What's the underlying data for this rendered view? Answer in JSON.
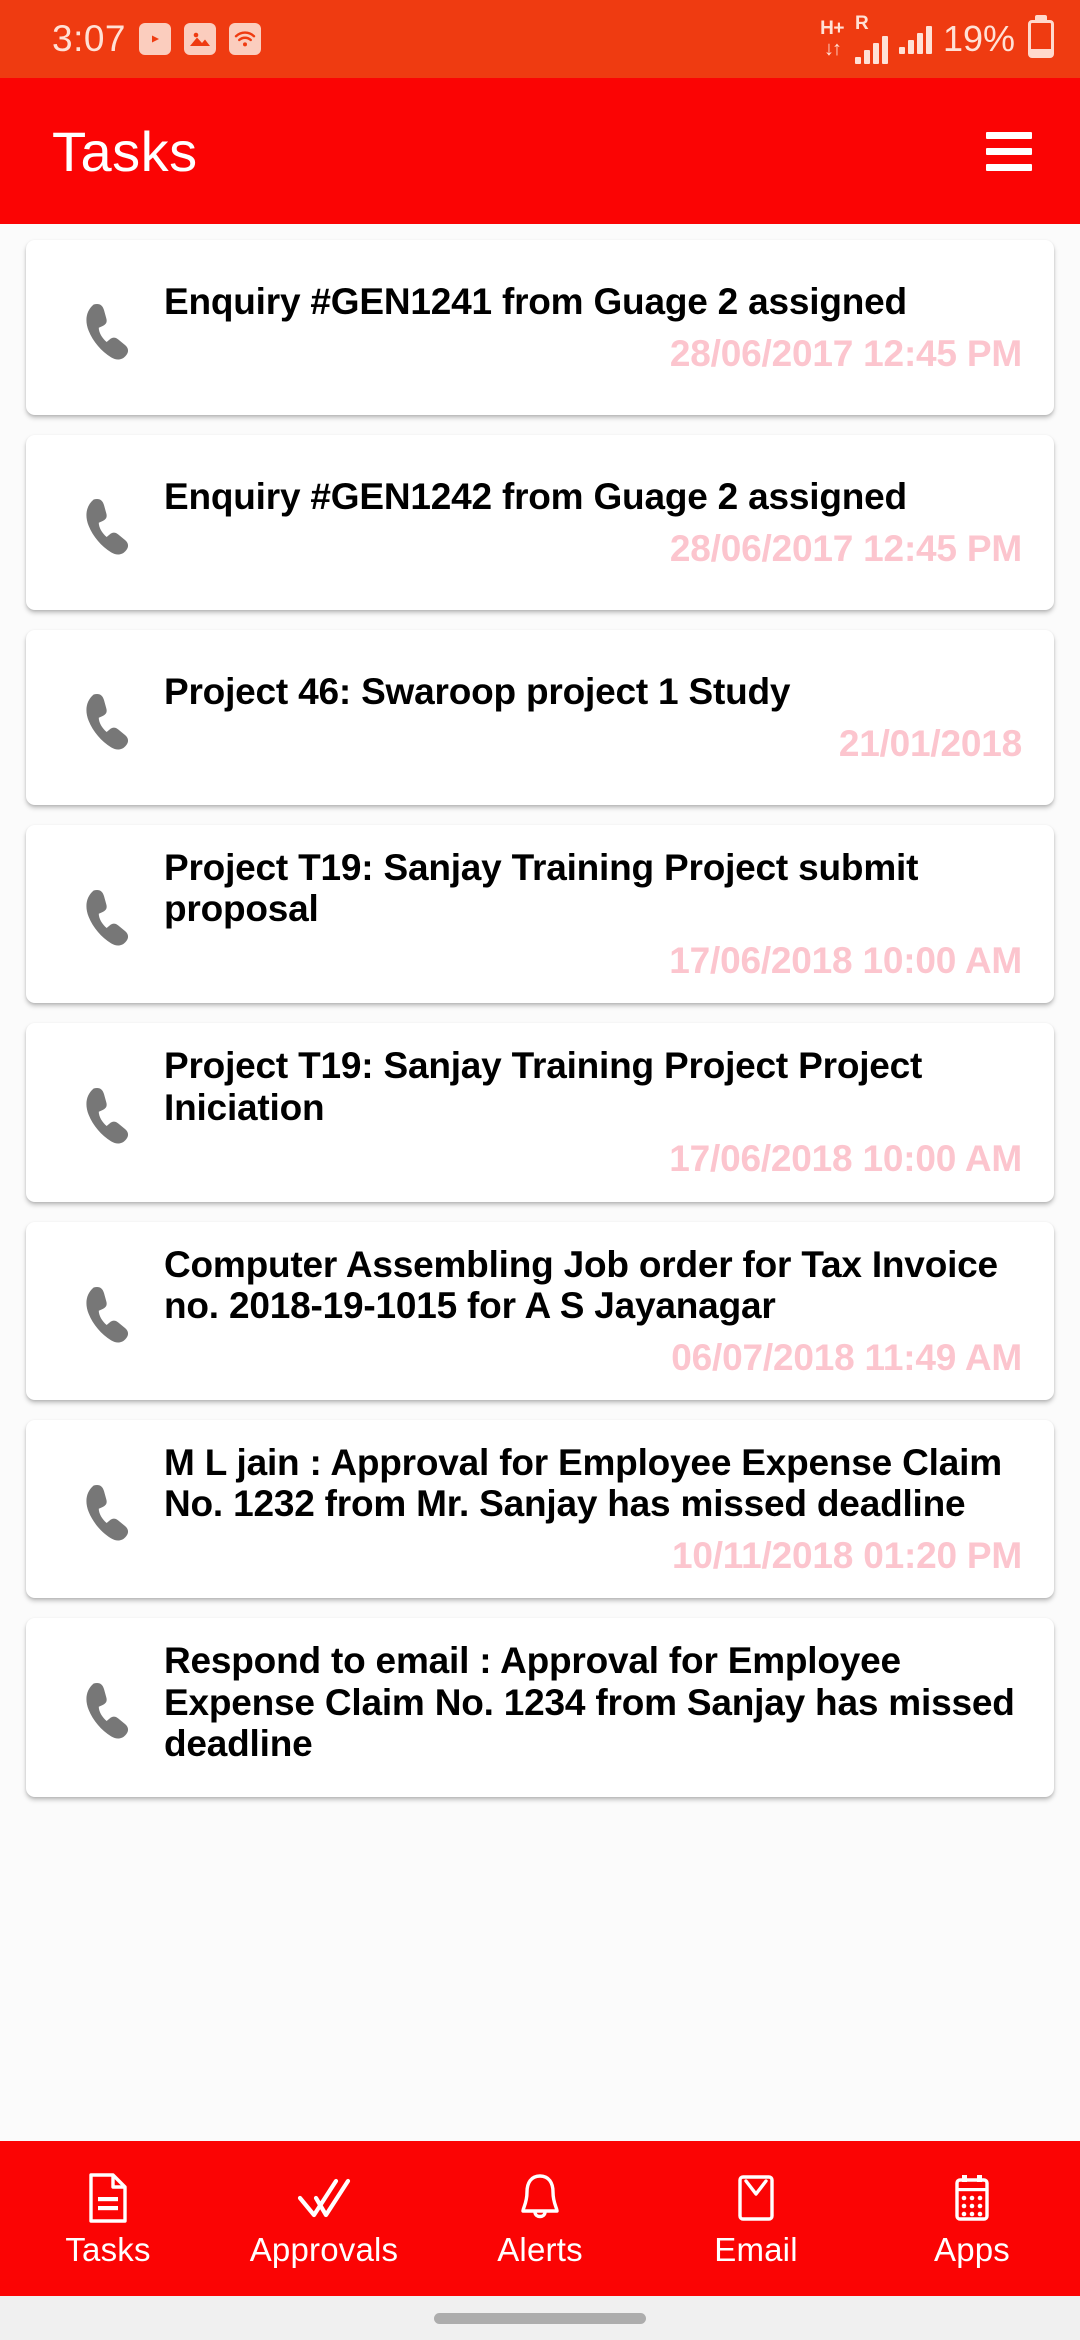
{
  "status_bar": {
    "clock": "3:07",
    "left_icons": [
      "youtube-icon",
      "gallery-icon",
      "wifi-icon"
    ],
    "network_type": "H+",
    "network_arrows": "↓↑",
    "roaming_label": "R",
    "battery_percent": "19%",
    "battery_level": 19,
    "background_color": "#ef3b11",
    "foreground_color": "#ffe1d6"
  },
  "app_bar": {
    "title": "Tasks",
    "menu_icon": "hamburger-icon",
    "background_color": "#fb0404",
    "text_color": "#ffffff"
  },
  "colors": {
    "accent": "#fb0404",
    "status_bar": "#ef3b11",
    "card_background": "#ffffff",
    "page_background": "#fbfbfb",
    "date_text": "#fcc5ce",
    "title_text": "#000000",
    "icon_gray": "#777777",
    "gesture_bar": "#f0f0f0"
  },
  "tasks": [
    {
      "icon": "phone-icon",
      "title": "Enquiry #GEN1241 from Guage 2 assigned",
      "date": "28/06/2017 12:45 PM"
    },
    {
      "icon": "phone-icon",
      "title": "Enquiry #GEN1242 from Guage 2 assigned",
      "date": "28/06/2017 12:45 PM"
    },
    {
      "icon": "phone-icon",
      "title": "Project 46: Swaroop project 1 Study",
      "date": "21/01/2018"
    },
    {
      "icon": "phone-icon",
      "title": "Project T19: Sanjay Training Project submit proposal",
      "date": "17/06/2018 10:00 AM"
    },
    {
      "icon": "phone-icon",
      "title": "Project T19: Sanjay Training Project Project Iniciation",
      "date": "17/06/2018 10:00 AM"
    },
    {
      "icon": "phone-icon",
      "title": "Computer Assembling Job order for Tax Invoice no. 2018-19-1015 for A S Jayanagar",
      "date": "06/07/2018 11:49 AM"
    },
    {
      "icon": "phone-icon",
      "title": "M L jain : Approval for Employee Expense Claim No. 1232 from Mr. Sanjay has missed deadline",
      "date": "10/11/2018 01:20 PM"
    },
    {
      "icon": "phone-icon",
      "title": "Respond to email : Approval for Employee Expense Claim No. 1234 from Sanjay has missed deadline",
      "date": ""
    }
  ],
  "bottom_nav": {
    "items": [
      {
        "label": "Tasks",
        "icon": "document-icon"
      },
      {
        "label": "Approvals",
        "icon": "double-check-icon"
      },
      {
        "label": "Alerts",
        "icon": "bell-icon"
      },
      {
        "label": "Email",
        "icon": "envelope-icon"
      },
      {
        "label": "Apps",
        "icon": "calculator-icon"
      }
    ],
    "active": "Tasks"
  },
  "gesture_bar": {
    "handle": "home-gesture-pill"
  }
}
